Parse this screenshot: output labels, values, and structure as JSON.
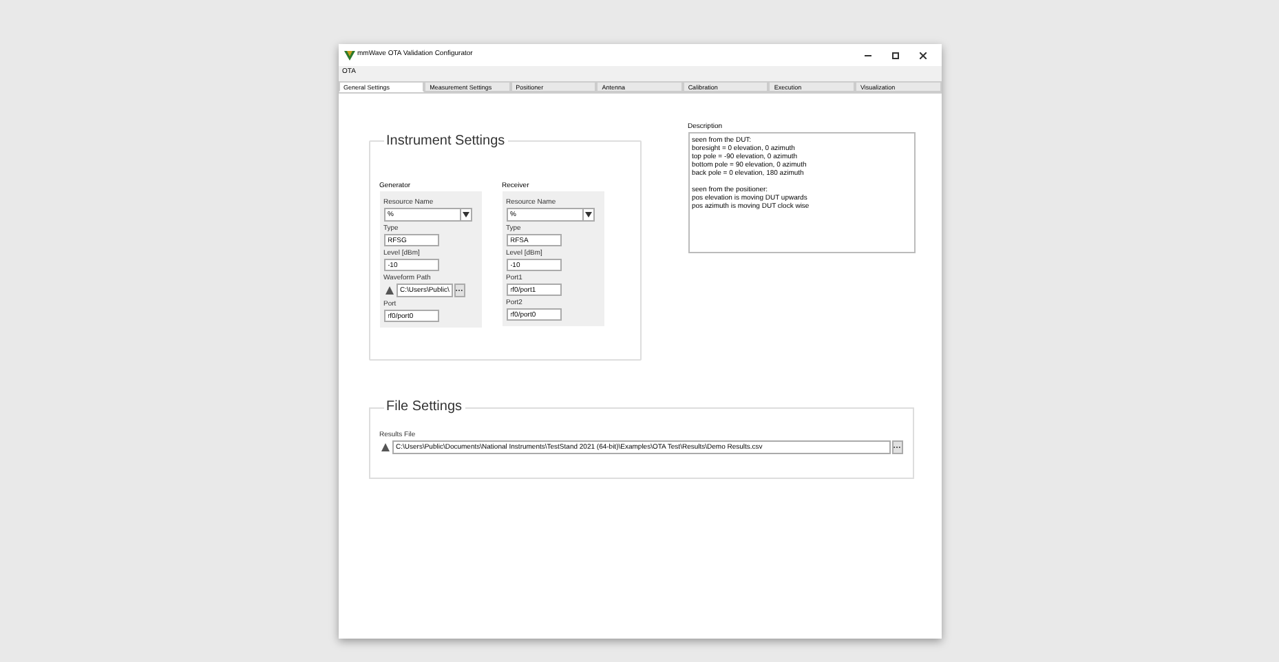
{
  "window": {
    "title": "mmWave OTA Validation Configurator"
  },
  "menu": [
    "OTA"
  ],
  "tabs": [
    {
      "label": "General Settings",
      "selected": true
    },
    {
      "label": "Measurement Settings",
      "selected": false
    },
    {
      "label": "Positioner",
      "selected": false
    },
    {
      "label": "Antenna",
      "selected": false
    },
    {
      "label": "Calibration",
      "selected": false
    },
    {
      "label": "Execution",
      "selected": false
    },
    {
      "label": "Visualization",
      "selected": false
    }
  ],
  "instrument_settings": {
    "title": "Instrument Settings",
    "groups": [
      {
        "title": "Generator",
        "fields": [
          {
            "kind": "combo",
            "label": "Resource Name",
            "value": "%"
          },
          {
            "kind": "text",
            "label": "Type",
            "value": "RFSG"
          },
          {
            "kind": "text",
            "label": "Level [dBm]",
            "value": "-10"
          },
          {
            "kind": "path",
            "label": "Waveform Path",
            "value": "C:\\Users\\Public\\"
          },
          {
            "kind": "text",
            "label": "Port",
            "value": "rf0/port0"
          }
        ]
      },
      {
        "title": "Receiver",
        "fields": [
          {
            "kind": "combo",
            "label": "Resource Name",
            "value": "%"
          },
          {
            "kind": "text",
            "label": "Type",
            "value": "RFSA"
          },
          {
            "kind": "text",
            "label": "Level [dBm]",
            "value": "-10"
          },
          {
            "kind": "text",
            "label": "Port1",
            "value": "rf0/port1"
          },
          {
            "kind": "text",
            "label": "Port2",
            "value": "rf0/port0"
          }
        ]
      }
    ]
  },
  "description": {
    "label": "Description",
    "paragraphs": [
      [
        "seen from the DUT:",
        "boresight = 0 elevation, 0 azimuth",
        "top pole = -90 elevation, 0 azimuth",
        "bottom pole = 90 elevation, 0 azimuth",
        "back pole = 0 elevation, 180 azimuth"
      ],
      [
        "seen from the positioner:",
        "pos elevation is moving DUT upwards",
        "pos azimuth is moving DUT clock wise"
      ]
    ]
  },
  "file_settings": {
    "title": "File Settings",
    "fields": [
      {
        "kind": "path",
        "label": "Results File",
        "value": "C:\\Users\\Public\\Documents\\National Instruments\\TestStand 2021 (64-bit)\\Examples\\OTA Test\\Results\\Demo Results.csv"
      }
    ]
  }
}
